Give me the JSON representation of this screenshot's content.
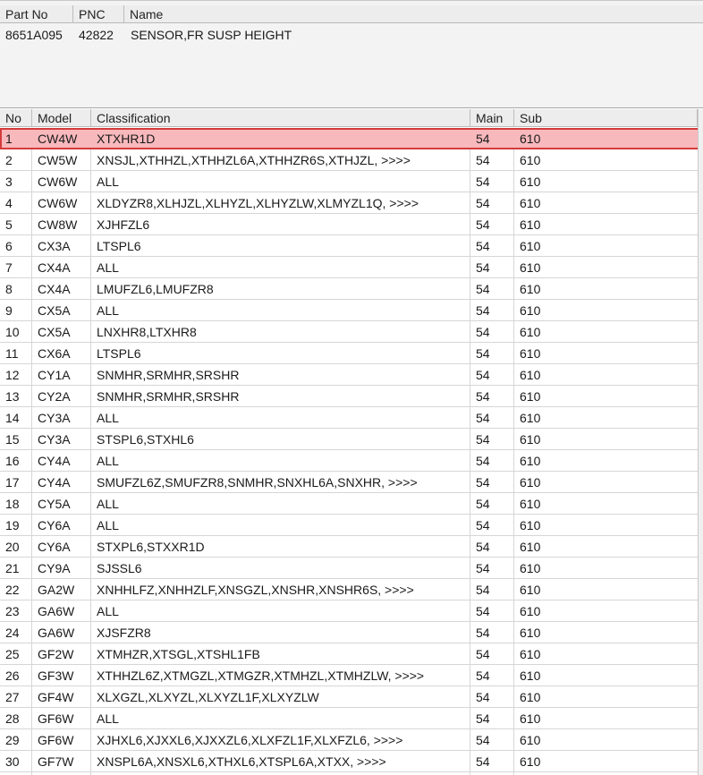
{
  "part_table": {
    "headers": [
      "Part No",
      "PNC",
      "Name"
    ],
    "row": {
      "part_no": "8651A095",
      "pnc": "42822",
      "name": "SENSOR,FR SUSP HEIGHT"
    }
  },
  "model_table": {
    "headers": [
      "No",
      "Model",
      "Classification",
      "Main",
      "Sub"
    ],
    "selected_row": 1,
    "rows": [
      {
        "no": "1",
        "model": "CW4W",
        "classification": "XTXHR1D",
        "main": "54",
        "sub": "610"
      },
      {
        "no": "2",
        "model": "CW5W",
        "classification": "XNSJL,XTHHZL,XTHHZL6A,XTHHZR6S,XTHJZL,  >>>>",
        "main": "54",
        "sub": "610"
      },
      {
        "no": "3",
        "model": "CW6W",
        "classification": "ALL",
        "main": "54",
        "sub": "610"
      },
      {
        "no": "4",
        "model": "CW6W",
        "classification": "XLDYZR8,XLHJZL,XLHYZL,XLHYZLW,XLMYZL1Q,  >>>>",
        "main": "54",
        "sub": "610"
      },
      {
        "no": "5",
        "model": "CW8W",
        "classification": "XJHFZL6",
        "main": "54",
        "sub": "610"
      },
      {
        "no": "6",
        "model": "CX3A",
        "classification": "LTSPL6",
        "main": "54",
        "sub": "610"
      },
      {
        "no": "7",
        "model": "CX4A",
        "classification": "ALL",
        "main": "54",
        "sub": "610"
      },
      {
        "no": "8",
        "model": "CX4A",
        "classification": "LMUFZL6,LMUFZR8",
        "main": "54",
        "sub": "610"
      },
      {
        "no": "9",
        "model": "CX5A",
        "classification": "ALL",
        "main": "54",
        "sub": "610"
      },
      {
        "no": "10",
        "model": "CX5A",
        "classification": "LNXHR8,LTXHR8",
        "main": "54",
        "sub": "610"
      },
      {
        "no": "11",
        "model": "CX6A",
        "classification": "LTSPL6",
        "main": "54",
        "sub": "610"
      },
      {
        "no": "12",
        "model": "CY1A",
        "classification": "SNMHR,SRMHR,SRSHR",
        "main": "54",
        "sub": "610"
      },
      {
        "no": "13",
        "model": "CY2A",
        "classification": "SNMHR,SRMHR,SRSHR",
        "main": "54",
        "sub": "610"
      },
      {
        "no": "14",
        "model": "CY3A",
        "classification": "ALL",
        "main": "54",
        "sub": "610"
      },
      {
        "no": "15",
        "model": "CY3A",
        "classification": "STSPL6,STXHL6",
        "main": "54",
        "sub": "610"
      },
      {
        "no": "16",
        "model": "CY4A",
        "classification": "ALL",
        "main": "54",
        "sub": "610"
      },
      {
        "no": "17",
        "model": "CY4A",
        "classification": "SMUFZL6Z,SMUFZR8,SNMHR,SNXHL6A,SNXHR,  >>>>",
        "main": "54",
        "sub": "610"
      },
      {
        "no": "18",
        "model": "CY5A",
        "classification": "ALL",
        "main": "54",
        "sub": "610"
      },
      {
        "no": "19",
        "model": "CY6A",
        "classification": "ALL",
        "main": "54",
        "sub": "610"
      },
      {
        "no": "20",
        "model": "CY6A",
        "classification": "STXPL6,STXXR1D",
        "main": "54",
        "sub": "610"
      },
      {
        "no": "21",
        "model": "CY9A",
        "classification": "SJSSL6",
        "main": "54",
        "sub": "610"
      },
      {
        "no": "22",
        "model": "GA2W",
        "classification": "XNHHLFZ,XNHHZLF,XNSGZL,XNSHR,XNSHR6S,  >>>>",
        "main": "54",
        "sub": "610"
      },
      {
        "no": "23",
        "model": "GA6W",
        "classification": "ALL",
        "main": "54",
        "sub": "610"
      },
      {
        "no": "24",
        "model": "GA6W",
        "classification": "XJSFZR8",
        "main": "54",
        "sub": "610"
      },
      {
        "no": "25",
        "model": "GF2W",
        "classification": "XTMHZR,XTSGL,XTSHL1FB",
        "main": "54",
        "sub": "610"
      },
      {
        "no": "26",
        "model": "GF3W",
        "classification": "XTHHZL6Z,XTMGZL,XTMGZR,XTMHZL,XTMHZLW,  >>>>",
        "main": "54",
        "sub": "610"
      },
      {
        "no": "27",
        "model": "GF4W",
        "classification": "XLXGZL,XLXYZL,XLXYZL1F,XLXYZLW",
        "main": "54",
        "sub": "610"
      },
      {
        "no": "28",
        "model": "GF6W",
        "classification": "ALL",
        "main": "54",
        "sub": "610"
      },
      {
        "no": "29",
        "model": "GF6W",
        "classification": "XJHXL6,XJXXL6,XJXXZL6,XLXFZL1F,XLXFZL6,  >>>>",
        "main": "54",
        "sub": "610"
      },
      {
        "no": "30",
        "model": "GF7W",
        "classification": "XNSPL6A,XNSXL6,XTHXL6,XTSPL6A,XTXX,  >>>>",
        "main": "54",
        "sub": "610"
      }
    ]
  },
  "colors": {
    "selected_fill": "#f8b9bd",
    "selected_border": "#d43b3b"
  }
}
